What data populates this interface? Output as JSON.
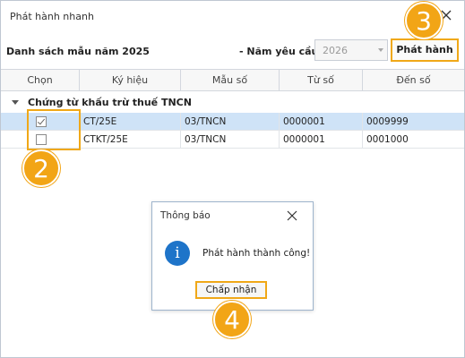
{
  "window": {
    "title": "Phát hành nhanh",
    "close_icon": "close-icon"
  },
  "toolbar": {
    "list_title": "Danh sách mẫu năm 2025",
    "year_label": "- Năm yêu cầu:",
    "year_value": "2026",
    "publish_label": "Phát hành"
  },
  "grid": {
    "columns": [
      "Chọn",
      "Ký hiệu",
      "Mẫu số",
      "Từ số",
      "Đến số"
    ],
    "group_label": "Chứng từ khấu trừ thuế TNCN",
    "rows": [
      {
        "checked": true,
        "ky_hieu": "CT/25E",
        "mau_so": "03/TNCN",
        "tu_so": "0000001",
        "den_so": "0009999",
        "selected": true
      },
      {
        "checked": false,
        "ky_hieu": "CTKT/25E",
        "mau_so": "03/TNCN",
        "tu_so": "0000001",
        "den_so": "0001000",
        "selected": false
      }
    ]
  },
  "dialog": {
    "title": "Thông báo",
    "message": "Phát hành thành công!",
    "button_label": "Chấp nhận",
    "icon": "info-icon"
  },
  "callouts": {
    "badge_2": "2",
    "badge_3": "3",
    "badge_4": "4",
    "color": "#f2a516"
  }
}
